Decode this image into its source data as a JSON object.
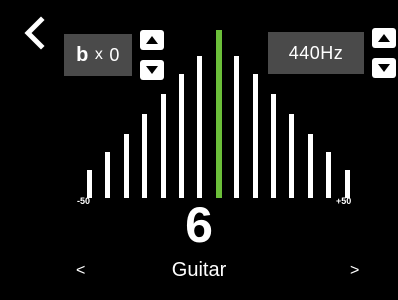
{
  "nav": {
    "back_icon": "chevron-left-icon"
  },
  "flat": {
    "symbol": "b",
    "times": "x",
    "value": "0"
  },
  "calibration": {
    "frequency": "440Hz"
  },
  "meter": {
    "scale_min": "-50",
    "scale_max": "+50",
    "needle_cents": 0,
    "bar_color": "#ffffff",
    "center_color": "#6cbf3a"
  },
  "string": {
    "number": "6",
    "type": "Guitar"
  },
  "navigation": {
    "prev": "<",
    "next": ">"
  }
}
